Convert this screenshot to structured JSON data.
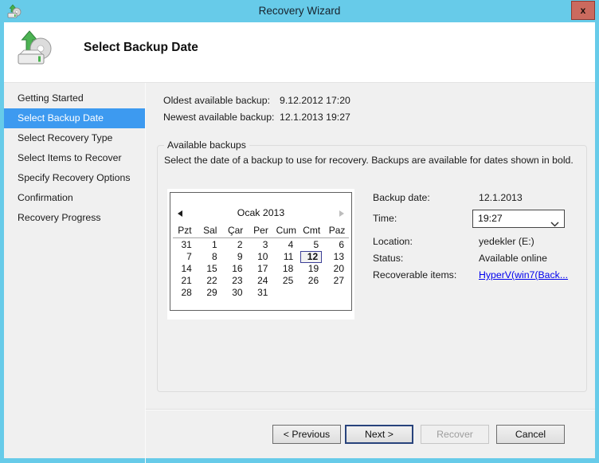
{
  "window": {
    "title": "Recovery Wizard",
    "close_glyph": "x"
  },
  "header": {
    "title": "Select Backup Date"
  },
  "sidebar": {
    "items": [
      {
        "label": "Getting Started",
        "active": false
      },
      {
        "label": "Select Backup Date",
        "active": true
      },
      {
        "label": "Select Recovery Type",
        "active": false
      },
      {
        "label": "Select Items to Recover",
        "active": false
      },
      {
        "label": "Specify Recovery Options",
        "active": false
      },
      {
        "label": "Confirmation",
        "active": false
      },
      {
        "label": "Recovery Progress",
        "active": false
      }
    ]
  },
  "summary": {
    "oldest": {
      "label": "Oldest available backup:",
      "value": "9.12.2012 17:20"
    },
    "newest": {
      "label": "Newest available backup:",
      "value": "12.1.2013 19:27"
    }
  },
  "group": {
    "title": "Available backups",
    "instruction": "Select the date of a backup to use for recovery. Backups are available for dates shown in bold."
  },
  "calendar": {
    "month_title": "Ocak 2013",
    "day_headers": [
      "Pzt",
      "Sal",
      "Çar",
      "Per",
      "Cum",
      "Cmt",
      "Paz"
    ],
    "weeks": [
      [
        "31",
        "1",
        "2",
        "3",
        "4",
        "5",
        "6"
      ],
      [
        "7",
        "8",
        "9",
        "10",
        "11",
        "12",
        "13"
      ],
      [
        "14",
        "15",
        "16",
        "17",
        "18",
        "19",
        "20"
      ],
      [
        "21",
        "22",
        "23",
        "24",
        "25",
        "26",
        "27"
      ],
      [
        "28",
        "29",
        "30",
        "31",
        "",
        "",
        ""
      ]
    ],
    "selected_day": "12"
  },
  "details": {
    "backup_date": {
      "label": "Backup date:",
      "value": "12.1.2013"
    },
    "time": {
      "label": "Time:",
      "value": "19:27"
    },
    "location": {
      "label": "Location:",
      "value": "yedekler (E:)"
    },
    "status": {
      "label": "Status:",
      "value": "Available online"
    },
    "recoverable": {
      "label": "Recoverable items:",
      "value": "HyperV(win7(Back..."
    }
  },
  "footer": {
    "previous_label": "< Previous",
    "next_label": "Next >",
    "recover_label": "Recover",
    "cancel_label": "Cancel"
  },
  "colors": {
    "titlebar_blue": "#67CBE9",
    "selection_blue": "#3D9AF0",
    "link_blue": "#0000EE",
    "close_button_red": "#CB6A5E",
    "background_gray": "#F0F0F0"
  }
}
